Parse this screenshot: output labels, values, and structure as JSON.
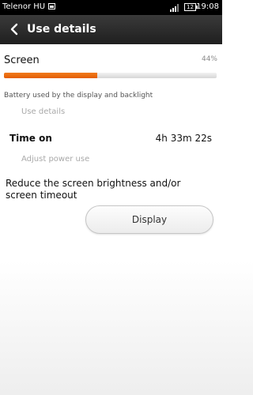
{
  "status_bar": {
    "carrier": "Telenor HU",
    "battery_level": "12",
    "time": "19:08",
    "icons": [
      "image-notification-icon",
      "signal-icon",
      "battery-icon"
    ]
  },
  "title_bar": {
    "back_icon": "chevron-left-icon",
    "title": "Use details"
  },
  "screen_usage": {
    "label": "Screen",
    "percent_text": "44%",
    "percent_value": 0.44,
    "accent_color": "#e8630a",
    "description": "Battery used by the display and backlight",
    "use_details_link": "Use details"
  },
  "time_on": {
    "label": "Time on",
    "value": "4h 33m 22s"
  },
  "adjust_link": "Adjust power use",
  "suggestion": {
    "text": "Reduce the screen brightness and/or screen timeout",
    "button_label": "Display"
  }
}
